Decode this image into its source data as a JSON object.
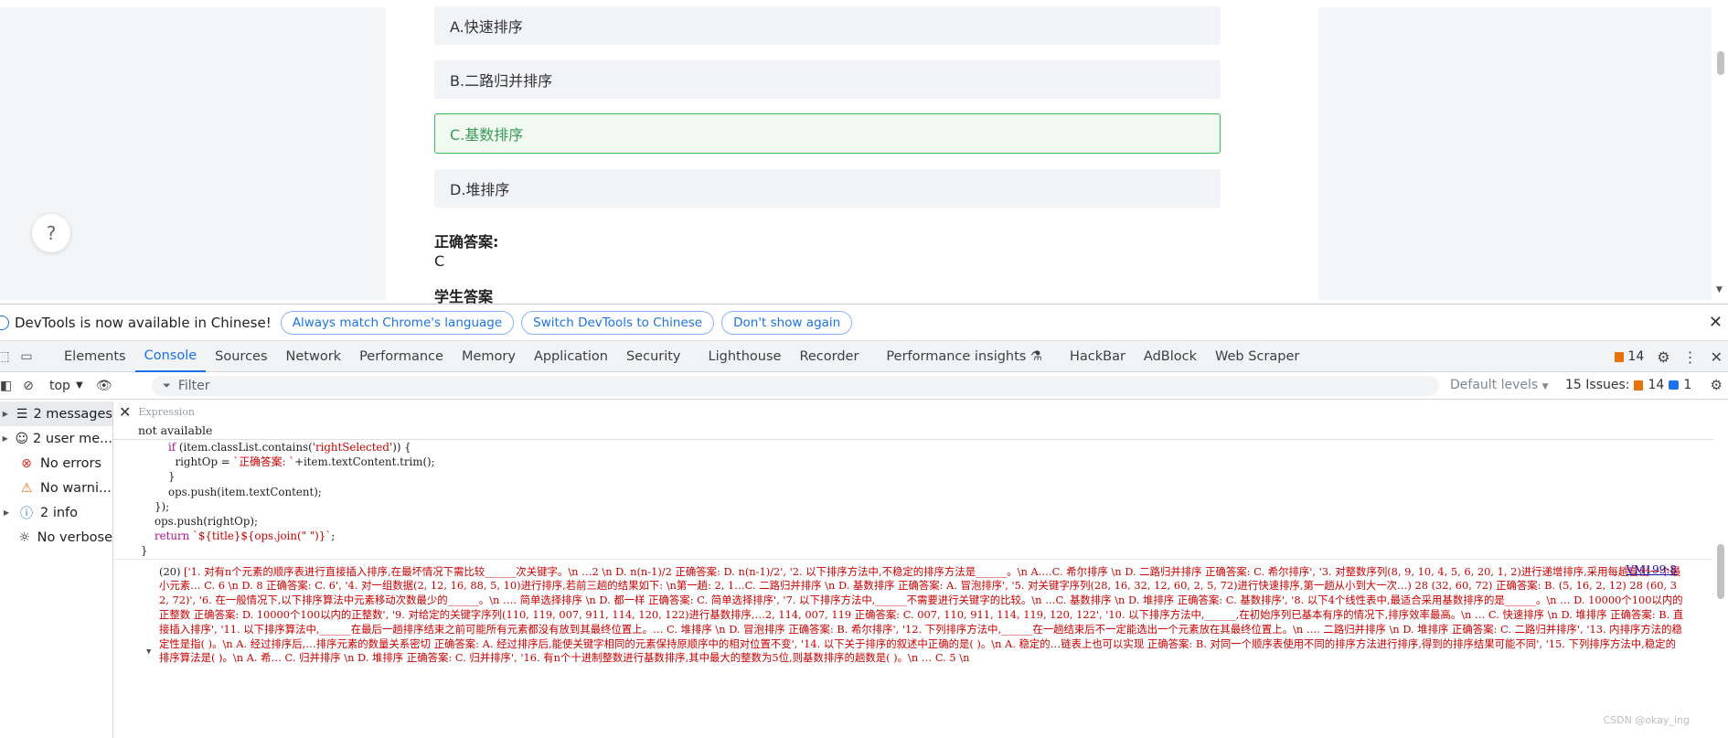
{
  "page": {
    "options": [
      {
        "label": "A.快速排序",
        "state": "normal"
      },
      {
        "label": "B.二路归并排序",
        "state": "normal"
      },
      {
        "label": "C.基数排序",
        "state": "correct"
      },
      {
        "label": "D.堆排序",
        "state": "normal"
      }
    ],
    "correct_answer_label": "正确答案:",
    "correct_answer_value": "C",
    "student_answer_label": "学生答案",
    "help_glyph": "?"
  },
  "devtools": {
    "infobar": {
      "message": "DevTools is now available in Chinese!",
      "buttons": [
        "Always match Chrome's language",
        "Switch DevTools to Chinese",
        "Don't show again"
      ]
    },
    "tabs": [
      "Elements",
      "Console",
      "Sources",
      "Network",
      "Performance",
      "Memory",
      "Application",
      "Security",
      "Lighthouse",
      "Recorder",
      "Performance insights",
      "HackBar",
      "AdBlock",
      "Web Scraper"
    ],
    "active_tab": "Console",
    "issues_count": "14",
    "toolbar": {
      "context": "top",
      "filter_placeholder": "Filter",
      "levels": "Default levels",
      "issues_label": "15 Issues:",
      "issues_warn": "14",
      "issues_info": "1"
    },
    "sidebar": [
      {
        "label": "2 messages",
        "icon": "list-icon",
        "selected": true,
        "expandable": true
      },
      {
        "label": "2 user me...",
        "icon": "user-icon",
        "selected": false,
        "expandable": true
      },
      {
        "label": "No errors",
        "icon": "error-icon",
        "selected": false,
        "expandable": false
      },
      {
        "label": "No warni...",
        "icon": "warning-icon",
        "selected": false,
        "expandable": false
      },
      {
        "label": "2 info",
        "icon": "info-icon",
        "selected": false,
        "expandable": true
      },
      {
        "label": "No verbose",
        "icon": "bug-icon",
        "selected": false,
        "expandable": false
      }
    ],
    "console": {
      "expression_placeholder": "Expression",
      "expression_result": "not available",
      "code_lines": [
        "        if (item.classList.contains('rightSelected')) {",
        "          rightOp = `正确答案: `+item.textContent.trim();",
        "        }",
        "        ops.push(item.textContent);",
        "    });",
        "    ops.push(rightOp);",
        "    return `${title}${ops.join(\" \")}`;",
        "}"
      ],
      "output_source": "VM199:8",
      "output_count": "(20)",
      "output_text": "['1.   对有n个元素的顺序表进行直接插入排序,在最坏情况下需比较______次关键字。\\n    …2 \\n                    D. n(n-1)/2 正确答案: D. n(n-1)/2', '2.   以下排序方法中,不稳定的排序方法是______。\\n                    A.…C. 希尔排序 \\n   D. 二路归并排序 正确答案: C. 希尔排序', '3.   对整数序列(8, 9, 10, 4, 5, 6, 20, 1, 2)进行递增排序,采用每趟冒出一个最小元素…          C. 6 \\n                    D. 8 正确答案: C. 6', '4.   对一组数据(2, 12, 16, 88, 5, 10)进行排序,若前三趟的结果如下: \\n第一趟: 2, 1…C. 二路归并排序 \\n                    D. 基数排序 正确答案: A. 冒泡排序', '5.   对关键字序列(28, 16, 32, 12, 60, 2, 5, 72)进行快速排序,第一趟从小到大一次…) 28 (32, 60, 72) 正确答案: B. (5, 16, 2, 12) 28 (60, 32, 72)', '6.   在一般情况下,以下排序算法中元素移动次数最少的______。\\n                    …. 简单选择排序 \\n                    D. 都一样 正确答案: C. 简单选择排序', '7.   以下排序方法中,______不需要进行关键字的比较。\\n                    …C. 基数排序 \\n                    D. 堆排序 正确答案: C. 基数排序', '8.   以下4个线性表中,最适合采用基数排序的是______。\\n                    …   D. 10000个100以内的正整数 正确答案: D. 10000个100以内的正整数', '9.   对给定的关键字序列(110, 119, 007, 911, 114, 120, 122)进行基数排序,…2, 114, 007, 119 正确答案: C. 007, 110, 911, 114, 119, 120, 122', '10.  以下排序方法中,______,在初始序列已基本有序的情况下,排序效率最高。\\n    … C. 快速排序 \\n                    D. 堆排序 正确答案: B. 直接插入排序', '11.  以下排序算法中,______在最后一趟排序结束之前可能所有元素都没有放到其最终位置上。…  C. 堆排序 \\n                    D. 冒泡排序 正确答案: B. 希尔排序', '12.  下列排序方法中,______在一趟结束后不一定能选出一个元素放在其最终位置上。\\n   …. 二路归并排序 \\n                    D. 堆排序 正确答案: C. 二路归并排序', '13.  内排序方法的稳定性是指(  )。\\n                    A. 经过排序后,…排序元素的数量关系密切 正确答案: A. 经过排序后,能使关键字相同的元素保持原顺序中的相对位置不变', '14.  以下关于排序的叙述中正确的是(  )。\\n                    A. 稳定的…链表上也可以实现 正确答案: B. 对同一个顺序表使用不同的排序方法进行排序,得到的排序结果可能不同', '15.  下列排序方法中,稳定的排序算法是(  )。\\n                    A. 希…  C. 归并排序 \\n                    D. 堆排序 正确答案: C. 归并排序', '16.  有n个十进制整数进行基数排序,其中最大的整数为5位,则基数排序的趟数是(  )。\\n    …     C. 5 \\n"
    },
    "watermark": "CSDN @okay_ing"
  },
  "colors": {
    "accent": "#1a73e8",
    "correct_border": "#36b85a",
    "correct_text": "#3b9a58",
    "console_string": "#c80000"
  }
}
